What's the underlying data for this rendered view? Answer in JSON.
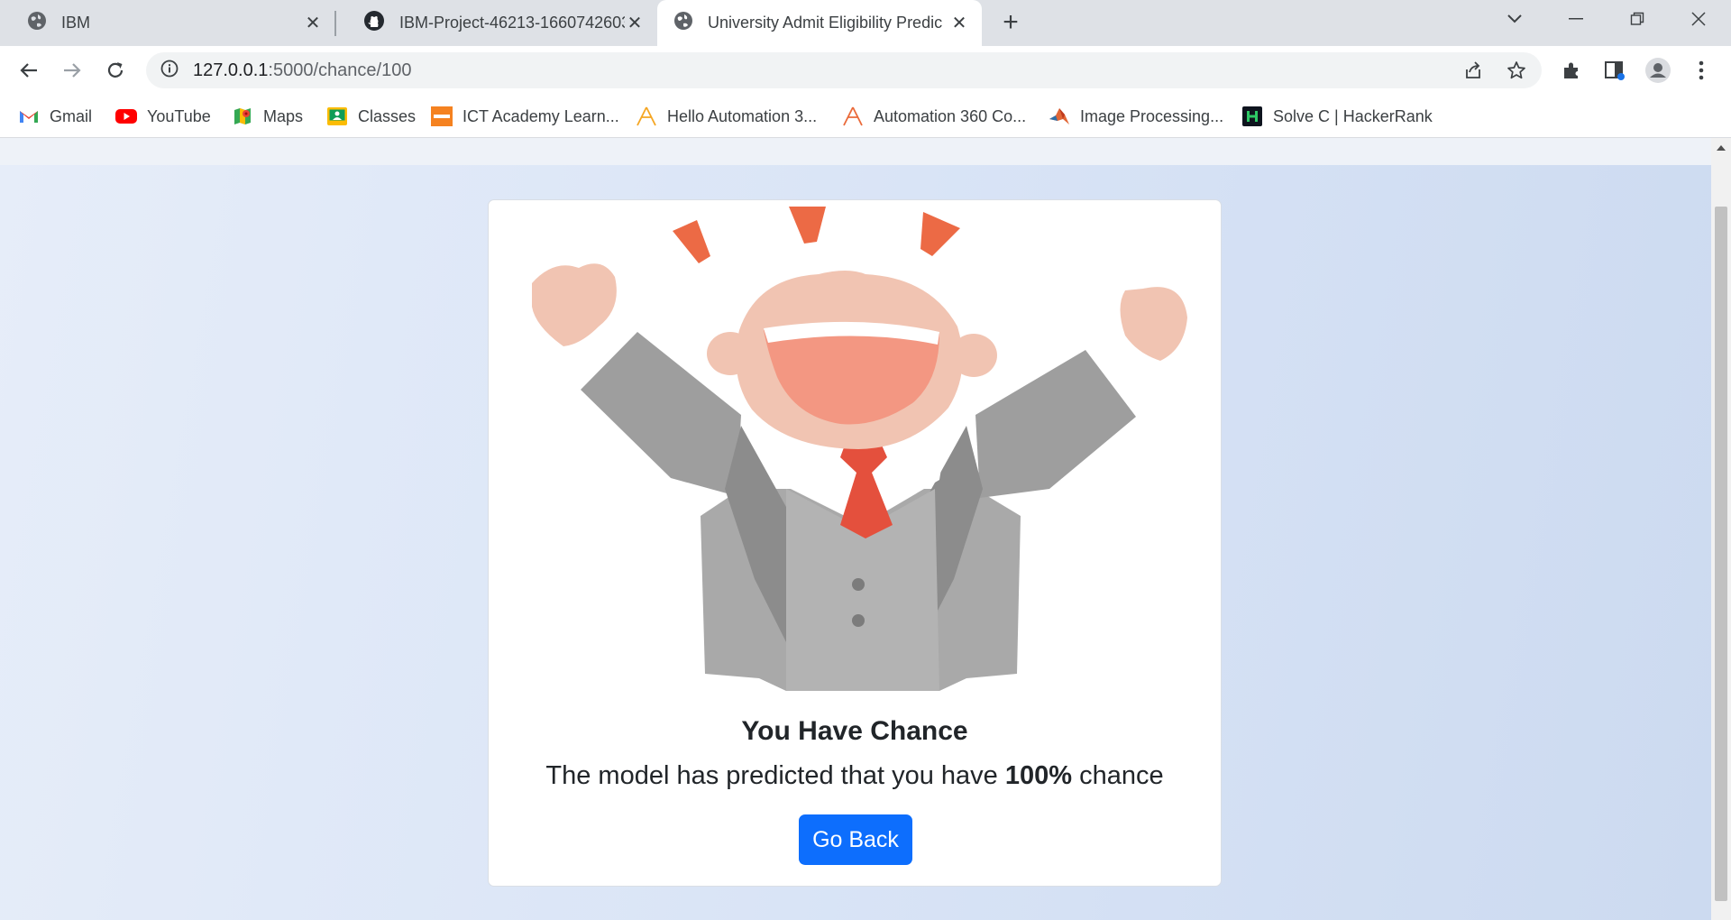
{
  "tabs": [
    {
      "title": "IBM",
      "icon": "globe-icon"
    },
    {
      "title": "IBM-Project-46213-1660742603/",
      "icon": "github-icon"
    },
    {
      "title": "University Admit Eligibility Predic",
      "icon": "globe-icon",
      "active": true
    }
  ],
  "address_bar": {
    "host": "127.0.0.1",
    "path": ":5000/chance/100"
  },
  "bookmarks": [
    {
      "label": "Gmail",
      "icon": "gmail-icon"
    },
    {
      "label": "YouTube",
      "icon": "youtube-icon"
    },
    {
      "label": "Maps",
      "icon": "maps-icon"
    },
    {
      "label": "Classes",
      "icon": "classroom-icon"
    },
    {
      "label": "ICT Academy Learn...",
      "icon": "ict-academy-icon"
    },
    {
      "label": "Hello Automation 3...",
      "icon": "automation-anywhere-icon"
    },
    {
      "label": "Automation 360 Co...",
      "icon": "automation-anywhere-icon"
    },
    {
      "label": "Image Processing...",
      "icon": "matlab-icon"
    },
    {
      "label": "Solve C | HackerRank",
      "icon": "hackerrank-icon"
    }
  ],
  "result": {
    "title": "You Have Chance",
    "message_prefix": "The model has predicted that you have ",
    "percent": "100%",
    "message_suffix": " chance",
    "button_label": "Go Back"
  },
  "colors": {
    "primary_button": "#0d6efd",
    "background_gradient_start": "#e6edf9",
    "background_gradient_end": "#ccdaf0"
  }
}
